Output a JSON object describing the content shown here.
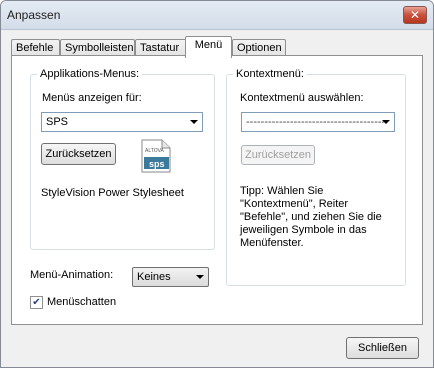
{
  "window": {
    "title": "Anpassen",
    "close_glyph": "✕"
  },
  "tabs": [
    {
      "label": "Befehle"
    },
    {
      "label": "Symbolleisten"
    },
    {
      "label": "Tastatur"
    },
    {
      "label": "Menü"
    },
    {
      "label": "Optionen"
    }
  ],
  "app_menus": {
    "group_label": "Applikations-Menus:",
    "show_for_label": "Menüs anzeigen für:",
    "show_for_value": "SPS",
    "reset_label": "Zurücksetzen",
    "icon_brand": "ALTOVA",
    "icon_badge": "sps",
    "description": "StyleVision Power Stylesheet"
  },
  "context_menu": {
    "group_label": "Kontextmenü:",
    "select_label": "Kontextmenü auswählen:",
    "select_value": "--------------------------------------",
    "reset_label": "Zurücksetzen",
    "tip": "Tipp: Wählen Sie\n\"Kontextmenü\", Reiter\n\"Befehle\", und ziehen Sie die\njeweiligen Symbole in das\nMenüfenster."
  },
  "animation": {
    "label": "Menü-Animation:",
    "value": "Keines"
  },
  "shadow": {
    "label": "Menüschatten",
    "checked": true,
    "check_glyph": "✔"
  },
  "footer": {
    "close_label": "Schließen"
  }
}
